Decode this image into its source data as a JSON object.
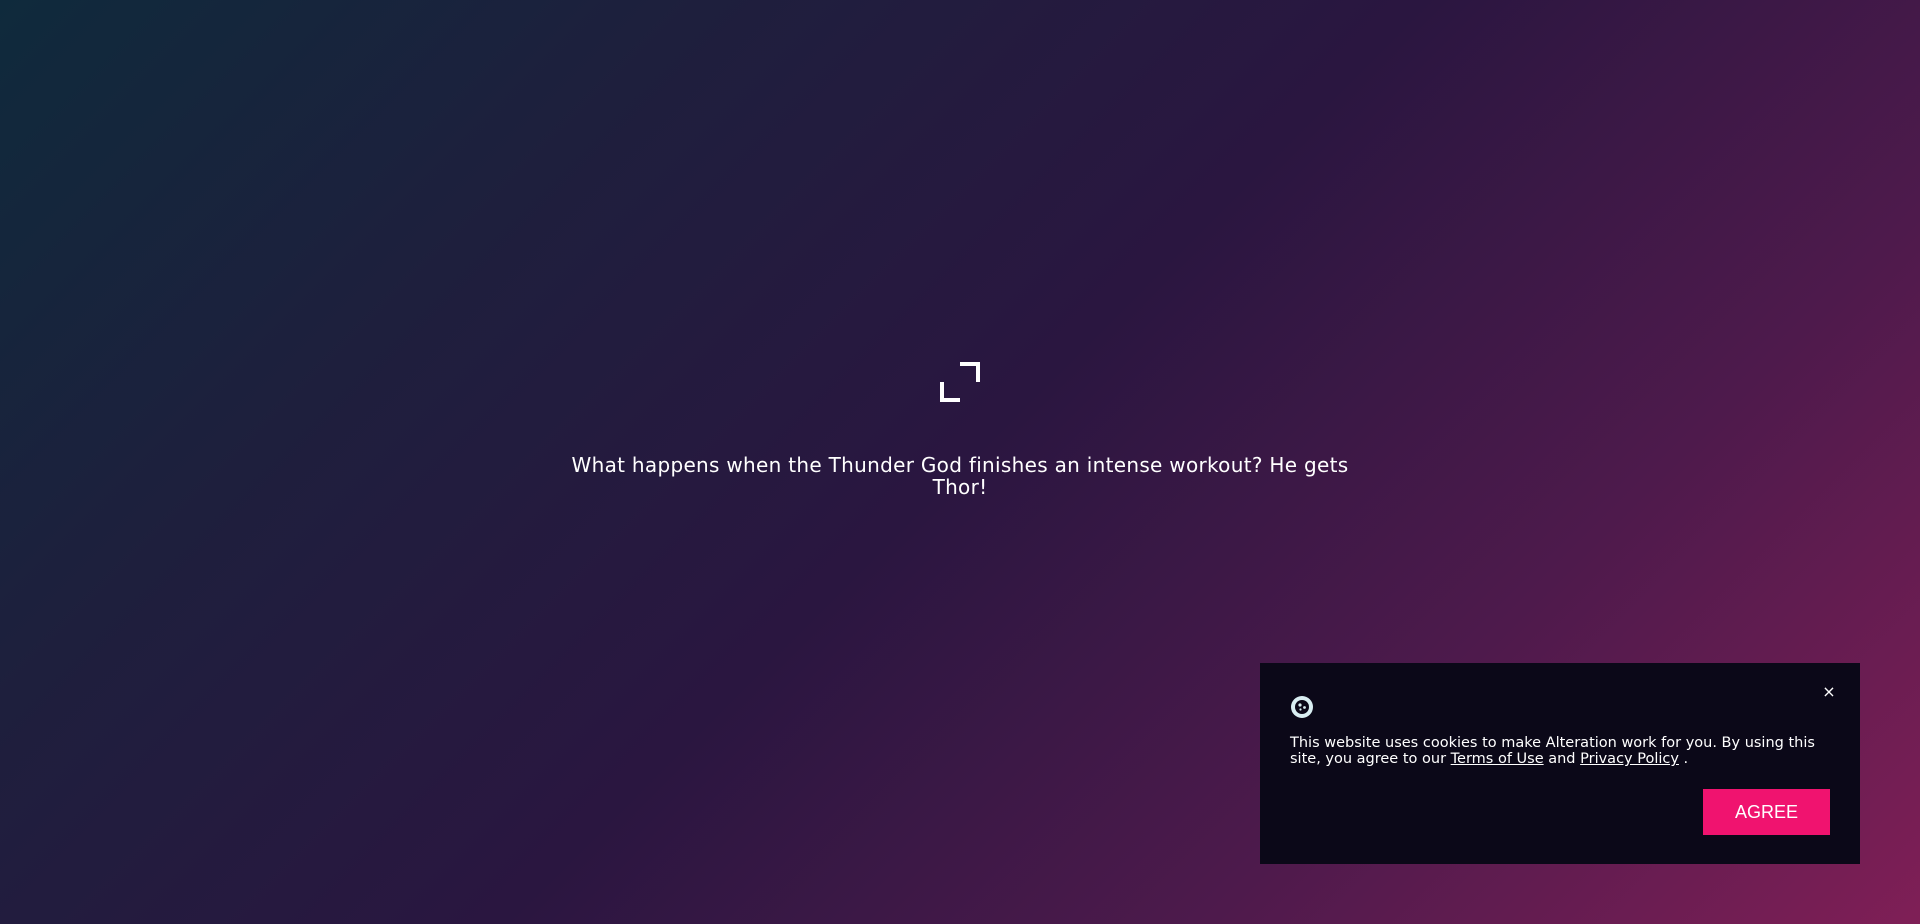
{
  "page": {
    "background_colors": [
      "#0f2a3c",
      "#2a1640",
      "#7f1f56"
    ]
  },
  "loader": {
    "icon": "expand-corners-icon"
  },
  "joke": {
    "text": "What happens when the Thunder God finishes an intense workout? He gets Thor!"
  },
  "cookie_banner": {
    "icon": "cookie-icon",
    "close_label": "×",
    "text_before": "This website uses cookies to make Alteration work for you. By using this site, you agree to our ",
    "terms_link": "Terms of Use",
    "text_and": " and ",
    "privacy_link": "Privacy Policy",
    "text_after": " .",
    "agree_label": "AGREE",
    "accent_color": "#f0136f",
    "background_color": "#0b0818"
  }
}
